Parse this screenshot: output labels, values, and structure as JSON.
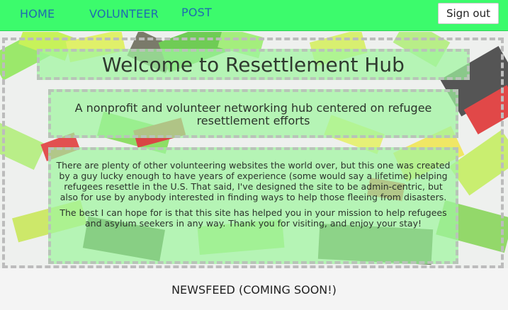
{
  "nav": {
    "home_label": "HOME",
    "volunteer_label": "VOLUNTEER",
    "post_label": "POST",
    "signout_label": "Sign out"
  },
  "colors": {
    "nav_background": "#3cfb6c",
    "nav_link": "#1e6bb0",
    "panel_background": "#a0f5a0"
  },
  "hero": {
    "title": "Welcome to Resettlement Hub",
    "subtitle": "A nonprofit and volunteer networking hub centered on refugee resettlement efforts",
    "paragraph1": "There are plenty of other volunteering websites the world over, but this one was created by a guy lucky enough to have years of experience (some would say a lifetime) helping refugees resettle in the U.S. That said, I've designed the site to be admin-centric, but also for use by anybody interested in finding ways to help those fleeing from disasters.",
    "paragraph2": "The best I can hope for is that this site has helped you in your mission to help refugees and asylum seekers in any way. Thank you for visiting, and enjoy your stay!"
  },
  "newsfeed": {
    "heading": "NEWSFEED (COMING SOON!)"
  }
}
